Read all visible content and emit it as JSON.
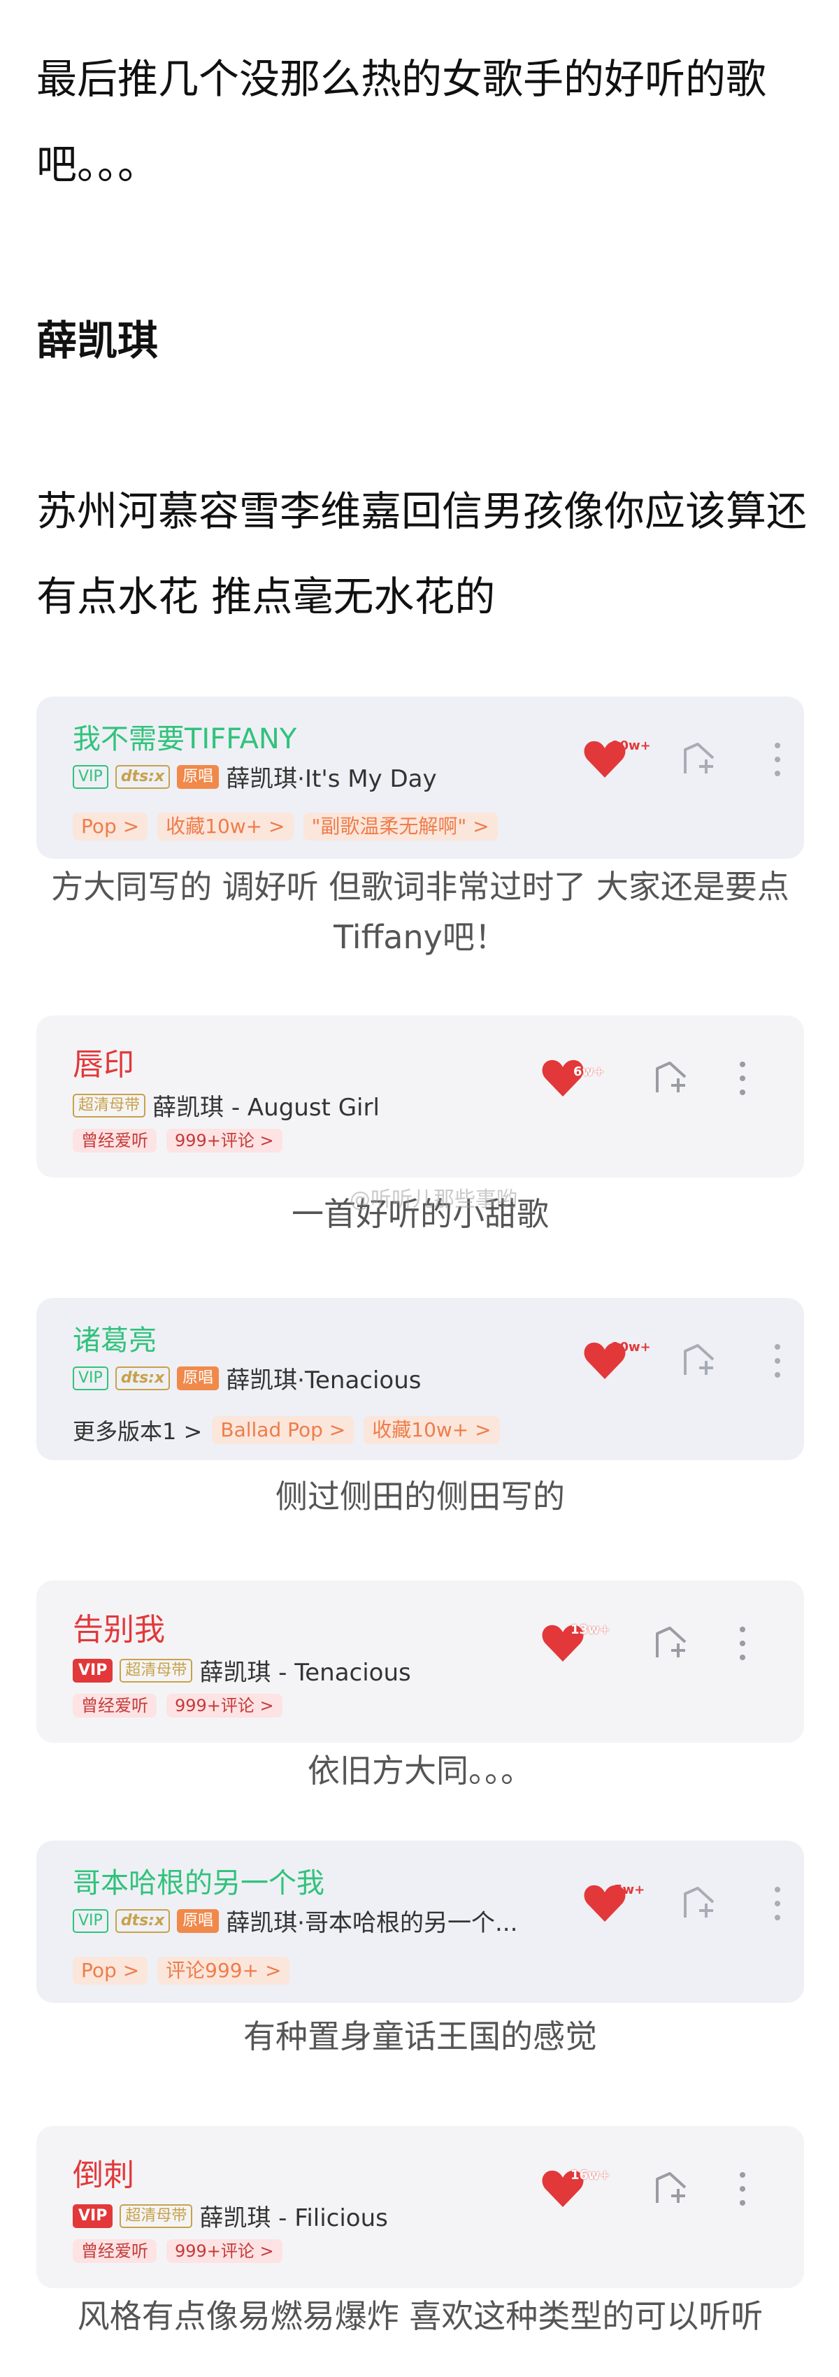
{
  "post": {
    "intro": "最后推几个没那么热的女歌手的好听的歌吧。。。",
    "artist_heading": "薛凯琪",
    "note": "苏州河慕容雪李维嘉回信男孩像你应该算还有点水花 推点毫无水花的"
  },
  "watermark": "@听听儿那些事哟",
  "songs": [
    {
      "title": "我不需要TIFFANY",
      "tags": [
        "VIP",
        "dts:x",
        "原唱"
      ],
      "artist_line": "薛凯琪·It's My Day",
      "chips": [
        "Pop >",
        "收藏10w+ >",
        "\"副歌温柔无解啊\" >"
      ],
      "likes": "10w+",
      "caption": "方大同写的 调好听 但歌词非常过时了 大家还是要点Tiffany吧！"
    },
    {
      "title": "唇印",
      "tags": [
        "超清母带"
      ],
      "artist_line": "薛凯琪 - August Girl",
      "chips": [
        "曾经爱听",
        "999+评论 >"
      ],
      "likes": "6w+",
      "caption": "一首好听的小甜歌"
    },
    {
      "title": "诸葛亮",
      "tags": [
        "VIP",
        "dts:x",
        "原唱"
      ],
      "artist_line": "薛凯琪·Tenacious",
      "prefix": "更多版本1 >",
      "chips": [
        "Ballad Pop >",
        "收藏10w+ >"
      ],
      "likes": "10w+",
      "caption": "侧过侧田的侧田写的"
    },
    {
      "title": "告别我",
      "tags": [
        "VIP",
        "超清母带"
      ],
      "artist_line": "薛凯琪 - Tenacious",
      "chips": [
        "曾经爱听",
        "999+评论 >"
      ],
      "likes": "13w+",
      "caption": "依旧方大同。。。"
    },
    {
      "title": "哥本哈根的另一个我",
      "tags": [
        "VIP",
        "dts:x",
        "原唱"
      ],
      "artist_line": "薛凯琪·哥本哈根的另一个...",
      "chips": [
        "Pop >",
        "评论999+ >"
      ],
      "likes": "5w+",
      "caption": "有种置身童话王国的感觉"
    },
    {
      "title": "倒刺",
      "tags": [
        "VIP",
        "超清母带"
      ],
      "artist_line": "薛凯琪 - Filicious",
      "chips": [
        "曾经爱听",
        "999+评论 >"
      ],
      "likes": "16w+",
      "caption": "风格有点像易燃易爆炸 喜欢这种类型的可以听听"
    }
  ],
  "icons": {
    "like": "heart-icon",
    "add": "add-to-playlist-icon",
    "more": "more-vertical-icon"
  },
  "colors": {
    "qq_green": "#31c27c",
    "netease_red": "#e2383a",
    "chip_orange": "#ee7d4a",
    "gold": "#c7a24a"
  }
}
